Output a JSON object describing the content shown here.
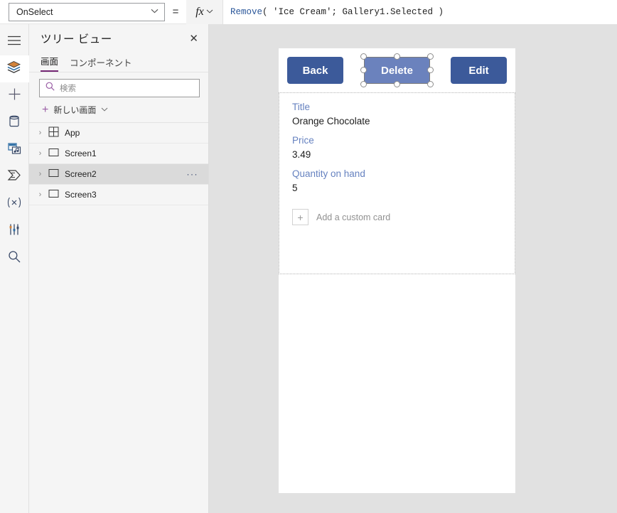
{
  "topbar": {
    "property_selected": "OnSelect",
    "equals": "=",
    "fx_label": "fx",
    "chevron": "⌄",
    "formula": {
      "fn": "Remove",
      "rest": "( 'Ice Cream'; Gallery1.Selected )",
      "full": "Remove( 'Ice Cream'; Gallery1.Selected )"
    }
  },
  "rail": {
    "items": [
      {
        "icon": "hamburger-menu-icon",
        "name": "menu"
      },
      {
        "icon": "layers-icon",
        "name": "tree-view",
        "active": true
      },
      {
        "icon": "plus-icon",
        "name": "insert"
      },
      {
        "icon": "database-icon",
        "name": "data"
      },
      {
        "icon": "media-icon",
        "name": "media"
      },
      {
        "icon": "power-automate-icon",
        "name": "power-automate"
      },
      {
        "icon": "variables-icon",
        "name": "variables",
        "label": "(x)"
      },
      {
        "icon": "tools-icon",
        "name": "tools"
      },
      {
        "icon": "search-icon",
        "name": "advanced-find"
      }
    ]
  },
  "tree_view": {
    "title": "ツリー ビュー",
    "close_label": "✕",
    "tabs": [
      {
        "label": "画面",
        "active": true
      },
      {
        "label": "コンポーネント",
        "active": false
      }
    ],
    "search": {
      "placeholder": "検索",
      "value": ""
    },
    "new_screen": {
      "label": "新しい画面",
      "chevron": "⌄",
      "plus": "+"
    },
    "items": [
      {
        "label": "App",
        "icon": "app-grid-icon",
        "expander": "›",
        "selected": false,
        "overflow": ""
      },
      {
        "label": "Screen1",
        "icon": "screen-icon",
        "expander": "›",
        "selected": false,
        "overflow": ""
      },
      {
        "label": "Screen2",
        "icon": "screen-icon",
        "expander": "›",
        "selected": true,
        "overflow": "···"
      },
      {
        "label": "Screen3",
        "icon": "screen-icon",
        "expander": "›",
        "selected": false,
        "overflow": ""
      }
    ]
  },
  "canvas": {
    "buttons": {
      "back": "Back",
      "delete": "Delete",
      "edit": "Edit"
    },
    "selected_control": "Delete",
    "form": {
      "fields": [
        {
          "label": "Title",
          "value": "Orange Chocolate"
        },
        {
          "label": "Price",
          "value": "3.49"
        },
        {
          "label": "Quantity on hand",
          "value": "5"
        }
      ],
      "add_custom_card": {
        "plus": "+",
        "label": "Add a custom card"
      }
    }
  },
  "colors": {
    "accent_purple": "#742774",
    "button_blue": "#3c5a9a",
    "button_blue_selected": "#6b82bd",
    "field_label_blue": "#6682c0",
    "workspace_gray": "#e1e1e1",
    "panel_gray": "#f5f5f5",
    "row_selected_gray": "#dadada"
  }
}
